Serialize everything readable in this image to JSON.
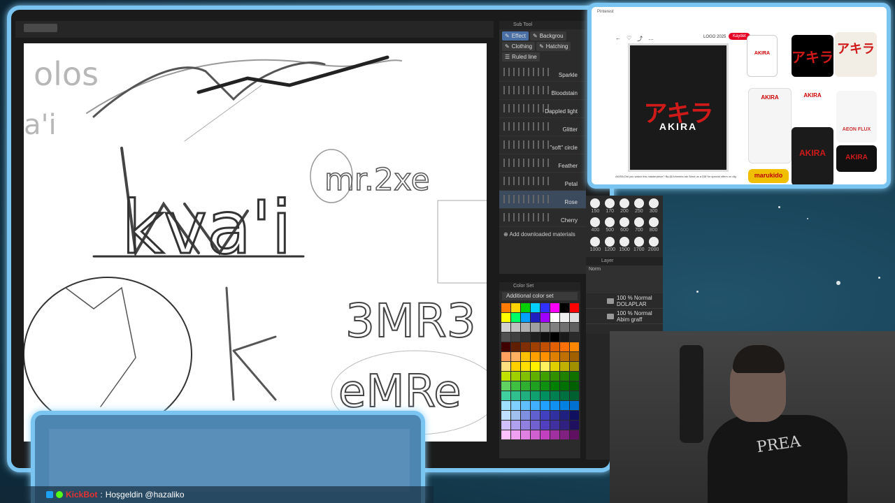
{
  "subtool": {
    "header": "Sub Tool",
    "tabs": [
      "Effect",
      "Backgrou",
      "Clothing",
      "Hatching",
      "Ruled line"
    ],
    "brushes": [
      "Sparkle",
      "Bloodstain",
      "Dappled light",
      "Glitter",
      "\"soft\" circle",
      "Feather",
      "Petal",
      "Rose",
      "Cherry"
    ],
    "add_materials": "Add downloaded materials"
  },
  "brush_sizes": [
    "150",
    "170",
    "200",
    "250",
    "300",
    "400",
    "500",
    "600",
    "700",
    "800",
    "1000",
    "1200",
    "1500",
    "1700",
    "2000"
  ],
  "layers": {
    "header": "Layer",
    "blend": "Norm",
    "rows": [
      {
        "opacity": "100 % Normal",
        "name": "DOLAPLAR"
      },
      {
        "opacity": "100 % Normal",
        "name": "Abim graff"
      }
    ]
  },
  "colorset": {
    "header": "Color Set",
    "selected": "Additional color set",
    "colors": [
      "#ff7a00",
      "#ffd400",
      "#00d000",
      "#00d0ff",
      "#3030ff",
      "#ff00ff",
      "#000000",
      "#ff0000",
      "#ffff00",
      "#00ff66",
      "#00a0ff",
      "#2020c0",
      "#a000ff",
      "#ffffff",
      "#f0f0f0",
      "#e0e0e0",
      "#d0d0d0",
      "#c0c0c0",
      "#b0b0b0",
      "#a0a0a0",
      "#909090",
      "#808080",
      "#707070",
      "#606060",
      "#505050",
      "#404040",
      "#303030",
      "#202020",
      "#101010",
      "#000000",
      "#1a1a1a",
      "#2a2a2a",
      "#400000",
      "#602000",
      "#803000",
      "#a04000",
      "#c05000",
      "#e06000",
      "#ff7000",
      "#ff8800",
      "#ffa060",
      "#ffb060",
      "#ffc000",
      "#ffa000",
      "#ff9000",
      "#e08000",
      "#c07000",
      "#a06000",
      "#ffe080",
      "#ffd000",
      "#ffe000",
      "#fff000",
      "#fff060",
      "#e0d000",
      "#c0b000",
      "#a09000",
      "#c0e000",
      "#a0d000",
      "#80c000",
      "#60b000",
      "#40a000",
      "#309000",
      "#208000",
      "#107000",
      "#60d060",
      "#40c040",
      "#30b030",
      "#20a020",
      "#109010",
      "#008000",
      "#007000",
      "#006000",
      "#40d0a0",
      "#30c090",
      "#20b080",
      "#10a070",
      "#009060",
      "#008050",
      "#007040",
      "#006030",
      "#a0e0ff",
      "#80d0ff",
      "#60c0ff",
      "#40b0ff",
      "#20a0ff",
      "#1090f0",
      "#0080e0",
      "#0070d0",
      "#c0e0ff",
      "#a0c0f0",
      "#8090e0",
      "#6060d0",
      "#4040c0",
      "#3030a0",
      "#202080",
      "#101060",
      "#d0c0ff",
      "#b0a0f0",
      "#9080e0",
      "#7060d0",
      "#5040c0",
      "#4030a0",
      "#302080",
      "#201060",
      "#ffc0ff",
      "#f0a0f0",
      "#e080e0",
      "#d060d0",
      "#c040c0",
      "#a030a0",
      "#802080",
      "#601060"
    ]
  },
  "pinterest": {
    "app": "Pinterest",
    "board": "LOGO 2025",
    "save": "Kaydet",
    "main_title": "アキラ",
    "main_sub": "AKIRA",
    "caption": "AKIRA Did you watch this masterpiece? By @Johnnies lab Send us a DM for special offers on dig",
    "thumbs": [
      {
        "label": "AKIRA"
      },
      {
        "label": "アキラ"
      },
      {
        "label": "アキラ"
      },
      {
        "label": "AKIRA"
      },
      {
        "label": "AKIRA"
      },
      {
        "label": "AEON FLUX"
      },
      {
        "label": "AKIRA"
      },
      {
        "label": "AKIRA"
      },
      {
        "label": "marukido"
      }
    ]
  },
  "chat": {
    "user": "KickBot",
    "separator": " : ",
    "message": "Hoşgeldin @hazaliko"
  },
  "canvas": {
    "sketch_words": [
      "kva'i",
      "mr.2xe",
      "3MR3",
      "eMRe",
      "k"
    ]
  },
  "shirt_print": "PREA"
}
